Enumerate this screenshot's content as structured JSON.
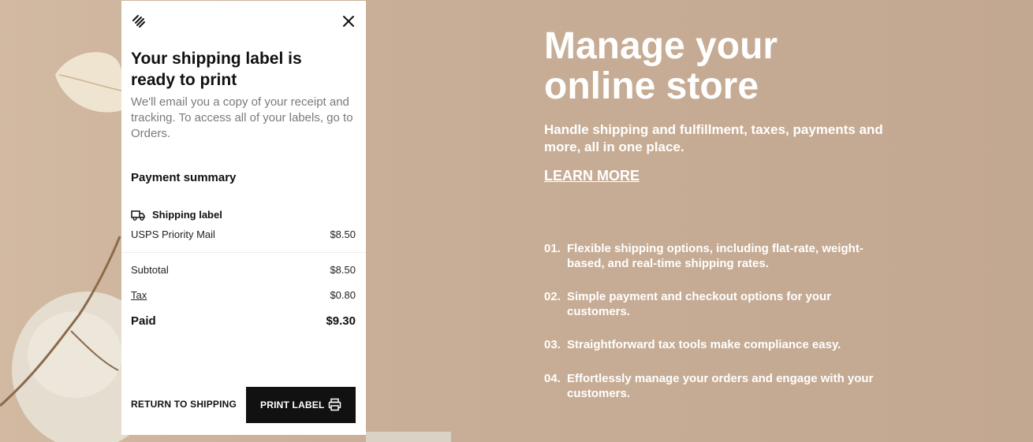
{
  "panel": {
    "close_icon": "close-icon",
    "logo_icon": "squarespace-logo-icon",
    "title": "Your shipping label is ready to print",
    "description": "We'll email you a copy of your receipt and tracking. To access all of your labels, go to Orders.",
    "payment_summary_title": "Payment summary",
    "item": {
      "icon": "truck-icon",
      "title": "Shipping label",
      "service": "USPS Priority Mail",
      "price": "$8.50"
    },
    "subtotal_label": "Subtotal",
    "subtotal_value": "$8.50",
    "tax_label": "Tax",
    "tax_value": "$0.80",
    "paid_label": "Paid",
    "paid_value": "$9.30",
    "return_label": "RETURN TO SHIPPING",
    "print_label": "PRINT LABEL",
    "print_icon": "printer-icon"
  },
  "hero": {
    "headline": "Manage your online store",
    "subhead": "Handle shipping and fulfillment, taxes, payments and more, all in one place.",
    "learn_more": "LEARN MORE",
    "features": [
      {
        "num": "01.",
        "text": "Flexible shipping options, including flat-rate, weight-based, and real-time shipping rates."
      },
      {
        "num": "02.",
        "text": "Simple payment and checkout options for your customers."
      },
      {
        "num": "03.",
        "text": "Straightforward tax tools make compliance easy."
      },
      {
        "num": "04.",
        "text": "Effortlessly manage your orders and engage with your customers."
      }
    ]
  },
  "colors": {
    "background": "#c6ad96",
    "panel": "#ffffff",
    "button": "#111111",
    "hero_text": "#ffffff"
  }
}
